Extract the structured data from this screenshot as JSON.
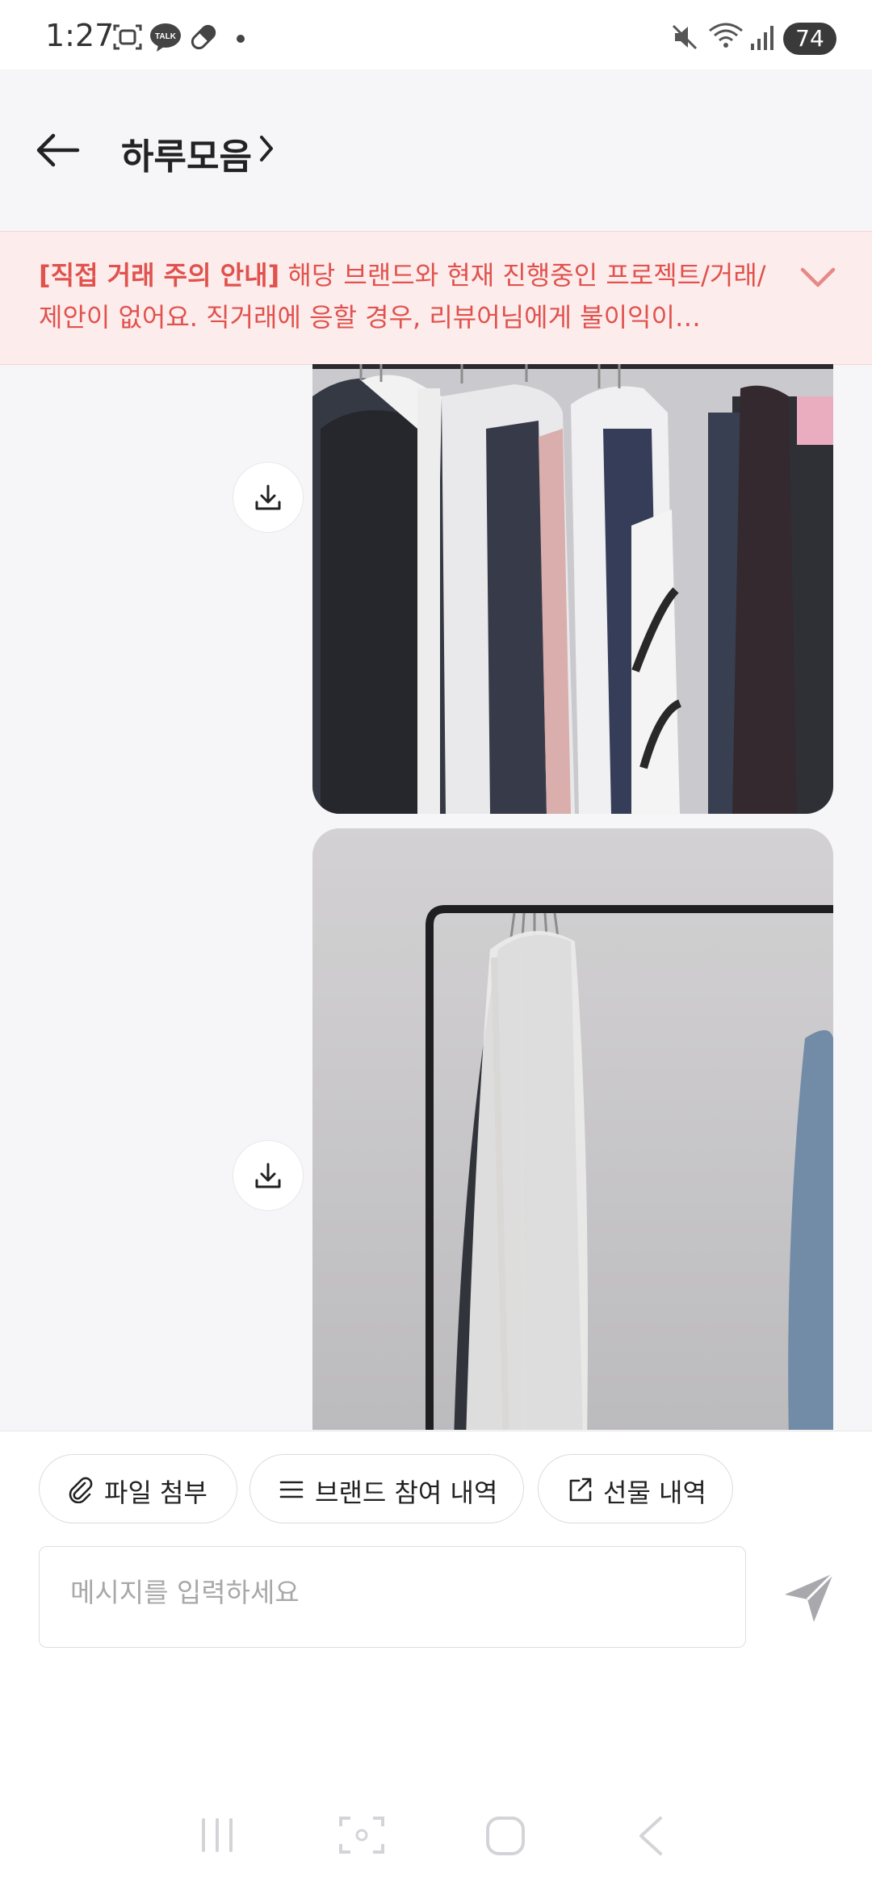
{
  "status_bar": {
    "time": "1:27",
    "battery": "74"
  },
  "header": {
    "title": "하루모음"
  },
  "notice": {
    "label": "[직접 거래 주의 안내]",
    "text": " 해당 브랜드와 현재 진행중인 프로젝트/거래/제안이 없어요. 직거래에 응할 경우, 리뷰어님에게 불이익이…"
  },
  "actions": {
    "file_attach": "파일 첨부",
    "brand_history": "브랜드 참여 내역",
    "gift_history": "선물 내역"
  },
  "composer": {
    "placeholder": "메시지를 입력하세요"
  },
  "icons": [
    "back-arrow-icon",
    "chevron-right-icon",
    "chevron-down-icon",
    "download-icon",
    "paperclip-icon",
    "list-icon",
    "external-link-icon",
    "send-icon"
  ]
}
